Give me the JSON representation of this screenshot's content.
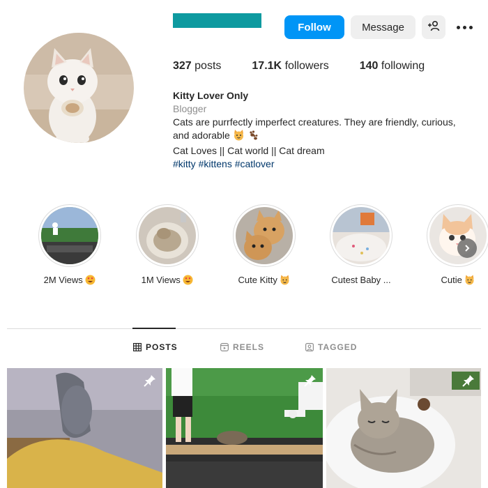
{
  "profile": {
    "posts_count": "327",
    "posts_label": "posts",
    "followers_count": "17.1K",
    "followers_label": "followers",
    "following_count": "140",
    "following_label": "following"
  },
  "actions": {
    "follow_label": "Follow",
    "message_label": "Message",
    "add_user_icon": "add-user-icon",
    "more_icon": "more-options-icon"
  },
  "bio": {
    "name": "Kitty Lover Only",
    "category": "Blogger",
    "line1": "Cats are purrfectly imperfect creatures. They are friendly, curious,",
    "line2": "and adorable",
    "line3": "Cat Loves || Cat world || Cat dream",
    "hashtags": "#kitty #kittens #catlover"
  },
  "highlights": [
    {
      "label": "2M Views",
      "emoji": "heart-eyes-emoji"
    },
    {
      "label": "1M Views",
      "emoji": "heart-eyes-emoji"
    },
    {
      "label": "Cute Kitty",
      "emoji": "cat-emoji"
    },
    {
      "label": "Cutest Baby ...",
      "emoji": ""
    },
    {
      "label": "Cutie",
      "emoji": "cat-emoji"
    }
  ],
  "tabs": [
    {
      "label": "POSTS",
      "icon": "grid-icon",
      "active": true
    },
    {
      "label": "REELS",
      "icon": "reels-icon",
      "active": false
    },
    {
      "label": "TAGGED",
      "icon": "tagged-icon",
      "active": false
    }
  ],
  "colors": {
    "accent": "#0095f6",
    "username_bar": "#0e9aa0",
    "hashtag": "#00376b",
    "muted": "#8e8e8e"
  }
}
